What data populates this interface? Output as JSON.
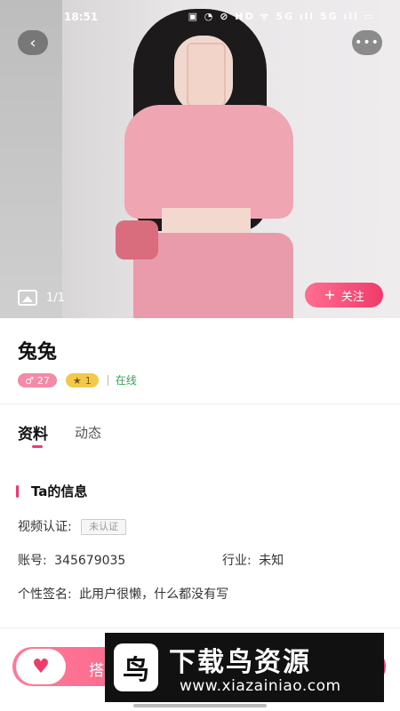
{
  "status_bar": {
    "time": "18:51",
    "indicators": "▣ ◔ ⊘ HD ᯤ 5G ıll 5G ıll ▭"
  },
  "photo": {
    "counter": "1/1",
    "follow_label": "关注",
    "follow_icon": "+",
    "back_icon": "‹",
    "more_icon": "•••"
  },
  "profile": {
    "name": "兔兔",
    "badge_gender_value": "27",
    "badge_gender_symbol": "♂",
    "badge_level_value": "1",
    "badge_level_symbol": "★",
    "online_status": "在线"
  },
  "tabs": [
    {
      "label": "资料"
    },
    {
      "label": "动态"
    }
  ],
  "info": {
    "section_title": "Ta的信息",
    "video_verify_label": "视频认证:",
    "video_verify_value": "未认证",
    "account_label": "账号:",
    "account_value": "345679035",
    "industry_label": "行业:",
    "industry_value": "未知",
    "signature_label": "个性签名:",
    "signature_value": "此用户很懒，什么都没有写"
  },
  "bottom": {
    "action_label": "搭",
    "action_icon": "♥"
  },
  "watermark": {
    "title": "下载鸟资源",
    "url": "www.xiazainiao.com",
    "logo_char": "鸟"
  },
  "colors": {
    "accent": "#f03a6b",
    "online": "#33a853",
    "badge_pink": "#f28aa8",
    "badge_gold": "#f2c94c"
  }
}
